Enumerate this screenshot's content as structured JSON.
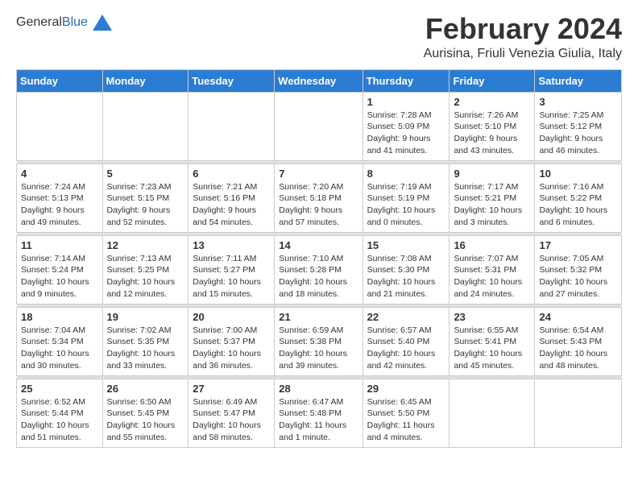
{
  "logo": {
    "general": "General",
    "blue": "Blue"
  },
  "title": "February 2024",
  "subtitle": "Aurisina, Friuli Venezia Giulia, Italy",
  "headers": [
    "Sunday",
    "Monday",
    "Tuesday",
    "Wednesday",
    "Thursday",
    "Friday",
    "Saturday"
  ],
  "weeks": [
    [
      {
        "day": "",
        "detail": ""
      },
      {
        "day": "",
        "detail": ""
      },
      {
        "day": "",
        "detail": ""
      },
      {
        "day": "",
        "detail": ""
      },
      {
        "day": "1",
        "detail": "Sunrise: 7:28 AM\nSunset: 5:09 PM\nDaylight: 9 hours\nand 41 minutes."
      },
      {
        "day": "2",
        "detail": "Sunrise: 7:26 AM\nSunset: 5:10 PM\nDaylight: 9 hours\nand 43 minutes."
      },
      {
        "day": "3",
        "detail": "Sunrise: 7:25 AM\nSunset: 5:12 PM\nDaylight: 9 hours\nand 46 minutes."
      }
    ],
    [
      {
        "day": "4",
        "detail": "Sunrise: 7:24 AM\nSunset: 5:13 PM\nDaylight: 9 hours\nand 49 minutes."
      },
      {
        "day": "5",
        "detail": "Sunrise: 7:23 AM\nSunset: 5:15 PM\nDaylight: 9 hours\nand 52 minutes."
      },
      {
        "day": "6",
        "detail": "Sunrise: 7:21 AM\nSunset: 5:16 PM\nDaylight: 9 hours\nand 54 minutes."
      },
      {
        "day": "7",
        "detail": "Sunrise: 7:20 AM\nSunset: 5:18 PM\nDaylight: 9 hours\nand 57 minutes."
      },
      {
        "day": "8",
        "detail": "Sunrise: 7:19 AM\nSunset: 5:19 PM\nDaylight: 10 hours\nand 0 minutes."
      },
      {
        "day": "9",
        "detail": "Sunrise: 7:17 AM\nSunset: 5:21 PM\nDaylight: 10 hours\nand 3 minutes."
      },
      {
        "day": "10",
        "detail": "Sunrise: 7:16 AM\nSunset: 5:22 PM\nDaylight: 10 hours\nand 6 minutes."
      }
    ],
    [
      {
        "day": "11",
        "detail": "Sunrise: 7:14 AM\nSunset: 5:24 PM\nDaylight: 10 hours\nand 9 minutes."
      },
      {
        "day": "12",
        "detail": "Sunrise: 7:13 AM\nSunset: 5:25 PM\nDaylight: 10 hours\nand 12 minutes."
      },
      {
        "day": "13",
        "detail": "Sunrise: 7:11 AM\nSunset: 5:27 PM\nDaylight: 10 hours\nand 15 minutes."
      },
      {
        "day": "14",
        "detail": "Sunrise: 7:10 AM\nSunset: 5:28 PM\nDaylight: 10 hours\nand 18 minutes."
      },
      {
        "day": "15",
        "detail": "Sunrise: 7:08 AM\nSunset: 5:30 PM\nDaylight: 10 hours\nand 21 minutes."
      },
      {
        "day": "16",
        "detail": "Sunrise: 7:07 AM\nSunset: 5:31 PM\nDaylight: 10 hours\nand 24 minutes."
      },
      {
        "day": "17",
        "detail": "Sunrise: 7:05 AM\nSunset: 5:32 PM\nDaylight: 10 hours\nand 27 minutes."
      }
    ],
    [
      {
        "day": "18",
        "detail": "Sunrise: 7:04 AM\nSunset: 5:34 PM\nDaylight: 10 hours\nand 30 minutes."
      },
      {
        "day": "19",
        "detail": "Sunrise: 7:02 AM\nSunset: 5:35 PM\nDaylight: 10 hours\nand 33 minutes."
      },
      {
        "day": "20",
        "detail": "Sunrise: 7:00 AM\nSunset: 5:37 PM\nDaylight: 10 hours\nand 36 minutes."
      },
      {
        "day": "21",
        "detail": "Sunrise: 6:59 AM\nSunset: 5:38 PM\nDaylight: 10 hours\nand 39 minutes."
      },
      {
        "day": "22",
        "detail": "Sunrise: 6:57 AM\nSunset: 5:40 PM\nDaylight: 10 hours\nand 42 minutes."
      },
      {
        "day": "23",
        "detail": "Sunrise: 6:55 AM\nSunset: 5:41 PM\nDaylight: 10 hours\nand 45 minutes."
      },
      {
        "day": "24",
        "detail": "Sunrise: 6:54 AM\nSunset: 5:43 PM\nDaylight: 10 hours\nand 48 minutes."
      }
    ],
    [
      {
        "day": "25",
        "detail": "Sunrise: 6:52 AM\nSunset: 5:44 PM\nDaylight: 10 hours\nand 51 minutes."
      },
      {
        "day": "26",
        "detail": "Sunrise: 6:50 AM\nSunset: 5:45 PM\nDaylight: 10 hours\nand 55 minutes."
      },
      {
        "day": "27",
        "detail": "Sunrise: 6:49 AM\nSunset: 5:47 PM\nDaylight: 10 hours\nand 58 minutes."
      },
      {
        "day": "28",
        "detail": "Sunrise: 6:47 AM\nSunset: 5:48 PM\nDaylight: 11 hours\nand 1 minute."
      },
      {
        "day": "29",
        "detail": "Sunrise: 6:45 AM\nSunset: 5:50 PM\nDaylight: 11 hours\nand 4 minutes."
      },
      {
        "day": "",
        "detail": ""
      },
      {
        "day": "",
        "detail": ""
      }
    ]
  ]
}
